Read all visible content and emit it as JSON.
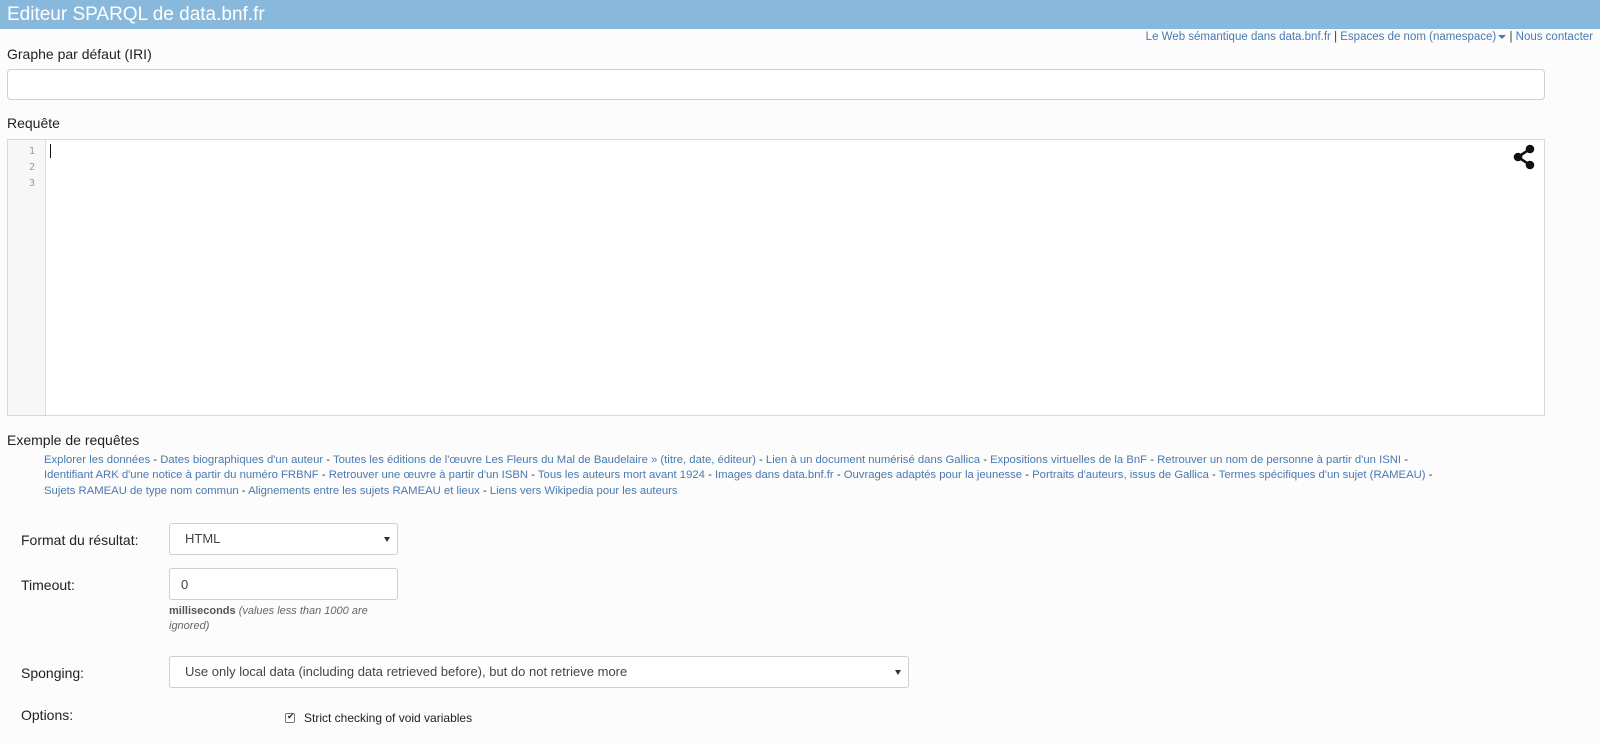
{
  "header": {
    "title": "Editeur SPARQL de data.bnf.fr"
  },
  "toplinks": {
    "semantic_web": "Le Web sémantique dans data.bnf.fr",
    "namespaces": "Espaces de nom (namespace)",
    "contact": "Nous contacter",
    "separator": "|"
  },
  "graph": {
    "label": "Graphe par défaut (IRI)",
    "value": ""
  },
  "query": {
    "label": "Requête",
    "line_numbers": [
      "1",
      "2",
      "3"
    ],
    "share_icon": "share-icon"
  },
  "examples": {
    "label": "Exemple de requêtes",
    "separator": "-",
    "items": [
      "Explorer les données",
      "Dates biographiques d'un auteur",
      "Toutes les éditions de l'œuvre Les Fleurs du Mal de Baudelaire » (titre, date, éditeur)",
      "Lien à un document numérisé dans Gallica",
      "Expositions virtuelles de la BnF",
      "Retrouver un nom de personne à partir d'un ISNI",
      "Identifiant ARK d'une notice à partir du numéro FRBNF",
      "Retrouver une œuvre à partir d'un ISBN",
      "Tous les auteurs mort avant 1924",
      "Images dans data.bnf.fr",
      "Ouvrages adaptés pour la jeunesse",
      "Portraits d'auteurs, issus de Gallica",
      "Termes spécifiques d'un sujet (RAMEAU)",
      "Sujets RAMEAU de type nom commun",
      "Alignements entre les sujets RAMEAU et lieux",
      "Liens vers Wikipedia pour les auteurs"
    ]
  },
  "form": {
    "format_label": "Format du résultat:",
    "format_value": "HTML",
    "timeout_label": "Timeout:",
    "timeout_value": "0",
    "timeout_help_unit": "milliseconds",
    "timeout_help_note": "(values less than 1000 are ignored)",
    "sponging_label": "Sponging:",
    "sponging_value": "Use only local data (including data retrieved before), but do not retrieve more",
    "options_label": "Options:",
    "strict_checking_label": "Strict checking of void variables",
    "strict_checking_checked": true
  },
  "colors": {
    "header_bg": "#88b9dc",
    "link": "#4a79b0"
  }
}
